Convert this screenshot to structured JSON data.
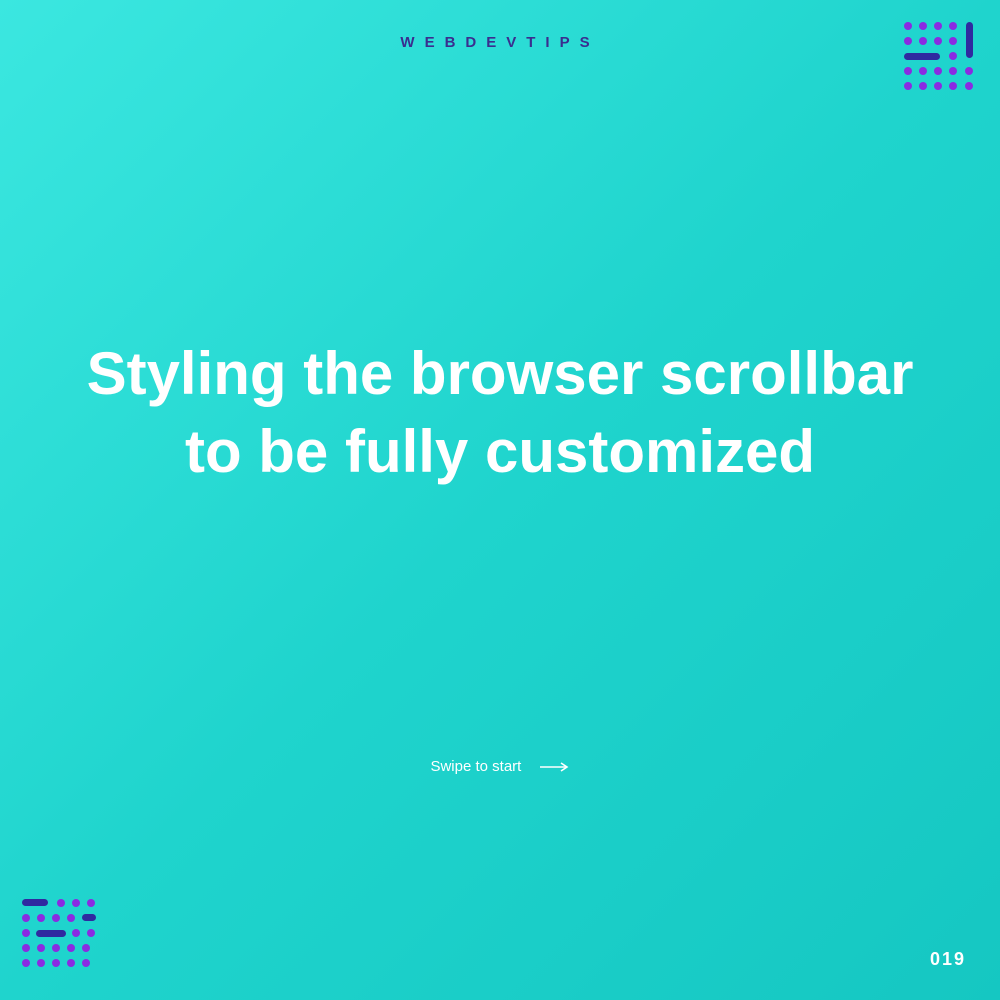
{
  "brand": "WEBDEVTIPS",
  "title": "Styling the browser scrollbar to be fully customized",
  "cta": "Swipe to start",
  "page_number": "019",
  "colors": {
    "accent": "#8a2be2",
    "accent2": "#2f2aa0",
    "text_heading": "#ffffff",
    "brand_text": "#3a2e8f"
  }
}
